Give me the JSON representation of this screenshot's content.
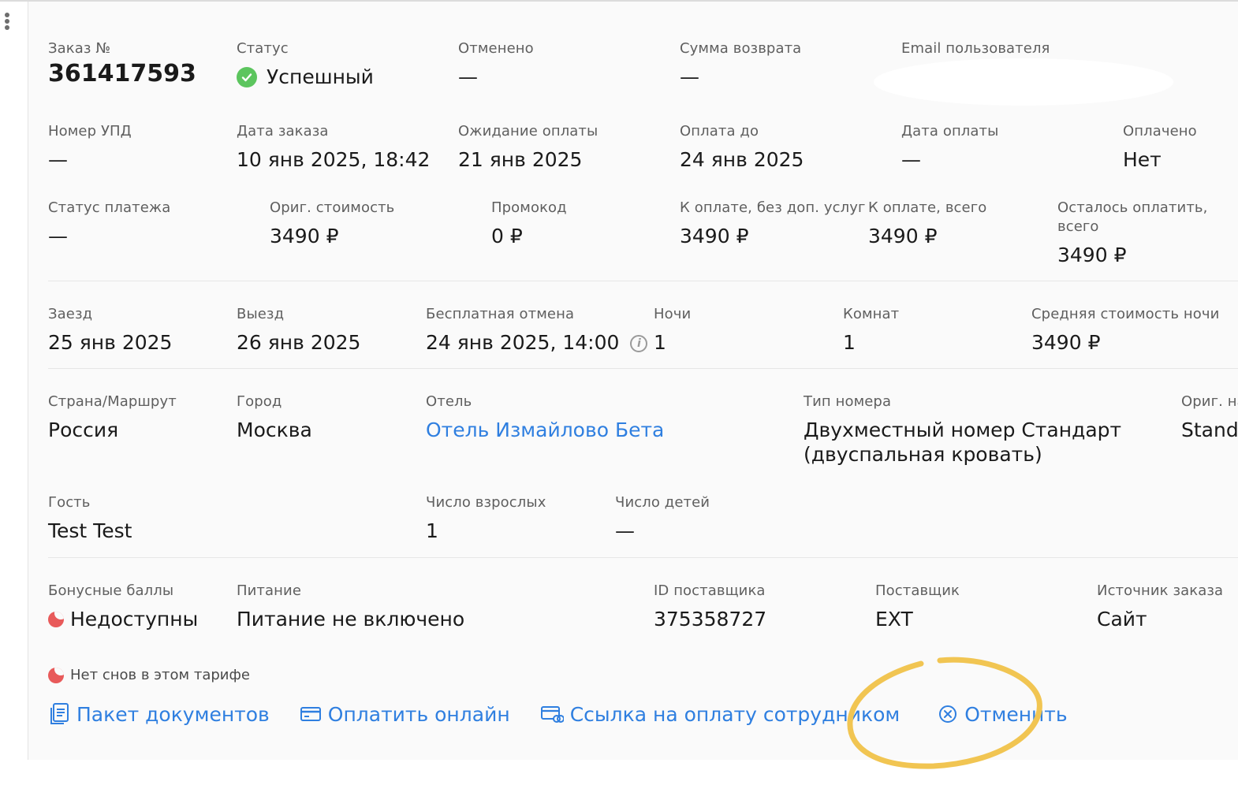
{
  "order": {
    "number_label": "Заказ №",
    "number": "361417593",
    "status_label": "Статус",
    "status": "Успешный",
    "cancelled_label": "Отменено",
    "cancelled": "—",
    "refund_label": "Сумма возврата",
    "refund": "—",
    "email_label": "Email пользователя"
  },
  "payment": {
    "upd_label": "Номер УПД",
    "upd": "—",
    "date_label": "Дата заказа",
    "date": "10 янв 2025, 18:42",
    "awaiting_label": "Ожидание оплаты",
    "awaiting": "21 янв 2025",
    "due_label": "Оплата до",
    "due": "24 янв 2025",
    "paid_date_label": "Дата оплаты",
    "paid_date": "—",
    "paid_label": "Оплачено",
    "paid": "Нет"
  },
  "cost": {
    "pay_status_label": "Статус платежа",
    "pay_status": "—",
    "orig_label": "Ориг. стоимость",
    "orig": "3490 ₽",
    "promo_label": "Промокод",
    "promo": "0 ₽",
    "no_extra_label": "К оплате, без доп. услуг",
    "no_extra": "3490 ₽",
    "total_label": "К оплате, всего",
    "total": "3490 ₽",
    "left_label_1": "Осталось оплатить,",
    "left_label_2": "всего",
    "left": "3490 ₽"
  },
  "stay": {
    "checkin_label": "Заезд",
    "checkin": "25 янв 2025",
    "checkout_label": "Выезд",
    "checkout": "26 янв 2025",
    "free_cancel_label": "Бесплатная отмена",
    "free_cancel": "24 янв 2025, 14:00",
    "nights_label": "Ночи",
    "nights": "1",
    "rooms_label": "Комнат",
    "rooms": "1",
    "avg_label": "Средняя стоимость ночи",
    "avg": "3490 ₽"
  },
  "hotel": {
    "country_label": "Страна/Маршрут",
    "country": "Россия",
    "city_label": "Город",
    "city": "Москва",
    "hotel_label": "Отель",
    "hotel": "Отель Измайлово Бета",
    "room_type_label": "Тип номера",
    "room_type_1": "Двухместный номер Стандарт",
    "room_type_2": "(двуспальная кровать)",
    "orig_name_label": "Ориг. на",
    "orig_name": "Stand"
  },
  "guests": {
    "guest_label": "Гость",
    "guest": "Test Test",
    "adults_label": "Число взрослых",
    "adults": "1",
    "children_label": "Число детей",
    "children": "—"
  },
  "misc": {
    "bonus_label": "Бонусные баллы",
    "bonus": "Недоступны",
    "meal_label": "Питание",
    "meal": "Питание не включено",
    "supplier_id_label": "ID поставщика",
    "supplier_id": "375358727",
    "supplier_label": "Поставщик",
    "supplier": "EXT",
    "source_label": "Источник заказа",
    "source": "Сайт"
  },
  "note": "Нет снов в этом тарифе",
  "actions": {
    "docs": "Пакет документов",
    "pay_online": "Оплатить онлайн",
    "pay_link": "Ссылка на оплату сотрудником",
    "cancel": "Отменить"
  },
  "colors": {
    "link": "#2f7fe0",
    "success": "#5cc55e",
    "warning_moon": "#e85a5a",
    "highlight": "#f1c552"
  }
}
